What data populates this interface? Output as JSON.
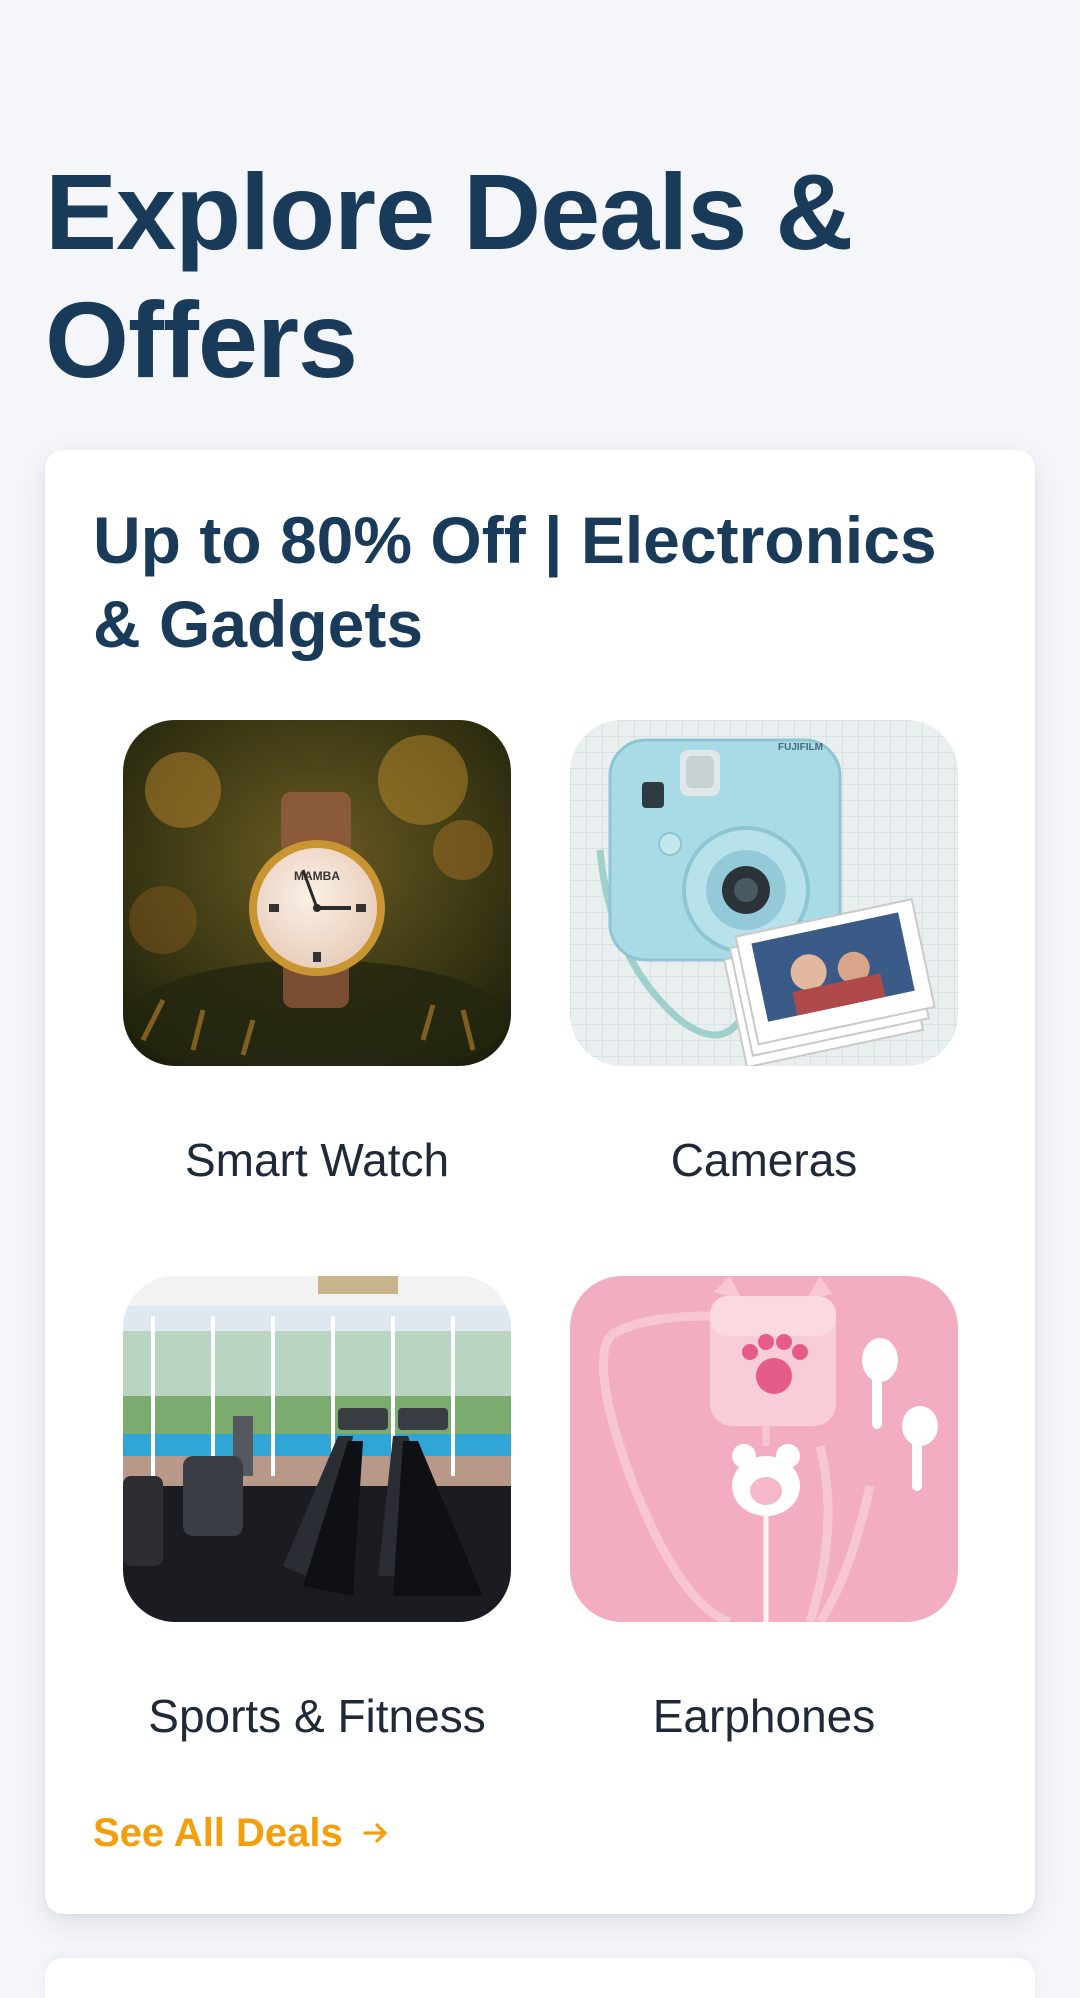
{
  "page": {
    "title": "Explore Deals & Offers"
  },
  "deal_card": {
    "title": "Up to 80% Off | Electronics & Gadgets",
    "tiles": [
      {
        "label": "Smart Watch",
        "image": "wristwatch-photo"
      },
      {
        "label": "Cameras",
        "image": "instant-camera-photo"
      },
      {
        "label": "Sports & Fitness",
        "image": "gym-treadmills-photo"
      },
      {
        "label": "Earphones",
        "image": "pink-earphones-case-photo"
      }
    ],
    "see_all": {
      "label": "See All Deals",
      "icon": "arrow-right-icon"
    }
  },
  "watch_brand": "MAMBA",
  "camera_brand": "FUJIFILM",
  "colors": {
    "title": "#193a59",
    "accent": "#f59e0b",
    "background": "#f5f6fa",
    "card": "#ffffff",
    "label_text": "#1f2937"
  }
}
